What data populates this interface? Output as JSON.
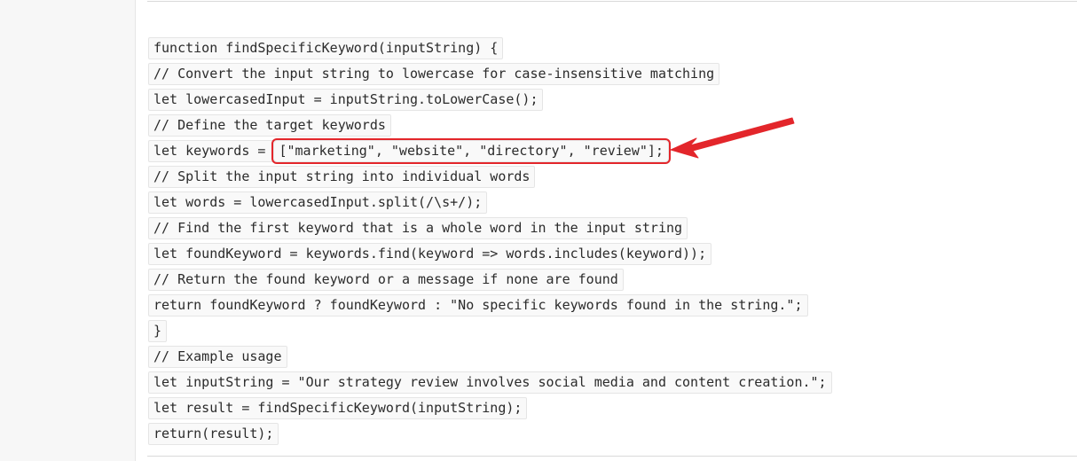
{
  "code": {
    "lines": [
      "function findSpecificKeyword(inputString) {",
      "// Convert the input string to lowercase for case-insensitive matching",
      "let lowercasedInput = inputString.toLowerCase();",
      "// Define the target keywords",
      "let keywords = ",
      "// Split the input string into individual words",
      "let words = lowercasedInput.split(/\\s+/);",
      "// Find the first keyword that is a whole word in the input string",
      "let foundKeyword = keywords.find(keyword => words.includes(keyword));",
      "// Return the found keyword or a message if none are found",
      "return foundKeyword ? foundKeyword : \"No specific keywords found in the string.\";",
      "}",
      "// Example usage",
      "let inputString = \"Our strategy review involves social media and content creation.\";",
      "let result = findSpecificKeyword(inputString);",
      "return(result);"
    ],
    "highlighted_array": "[\"marketing\", \"website\", \"directory\", \"review\"];"
  },
  "annotation": {
    "color": "#e3262b",
    "arrow_icon": "red-arrow-icon"
  }
}
